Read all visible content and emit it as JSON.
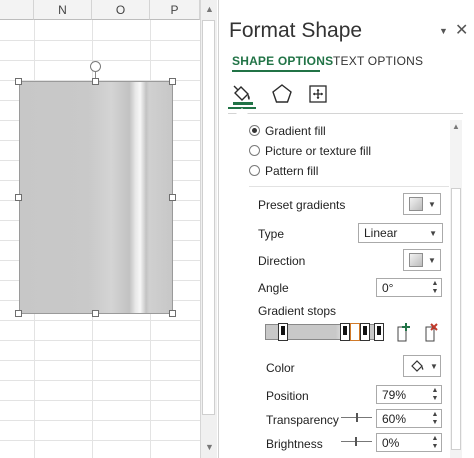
{
  "sheet": {
    "columns": [
      "N",
      "O",
      "P"
    ]
  },
  "pane": {
    "title": "Format Shape",
    "tabs": [
      "SHAPE OPTIONS",
      "TEXT OPTIONS"
    ],
    "active_tab": "SHAPE OPTIONS",
    "category_icons": [
      "fill-line-icon",
      "effects-icon",
      "size-properties-icon"
    ],
    "fill_options": [
      {
        "label": "Gradient fill",
        "selected": true
      },
      {
        "label": "Picture or texture fill",
        "selected": false
      },
      {
        "label": "Pattern fill",
        "selected": false
      }
    ],
    "preset_gradients_label": "Preset gradients",
    "type_label": "Type",
    "type_value": "Linear",
    "direction_label": "Direction",
    "angle_label": "Angle",
    "angle_value": "0°",
    "gradient_stops_label": "Gradient stops",
    "color_label": "Color",
    "position_label": "Position",
    "position_value": "79%",
    "transparency_label": "Transparency",
    "transparency_value": "60%",
    "brightness_label": "Brightness",
    "brightness_value": "0%"
  },
  "colors": {
    "accent": "#217346",
    "selected_stop": "#d07a2a"
  }
}
